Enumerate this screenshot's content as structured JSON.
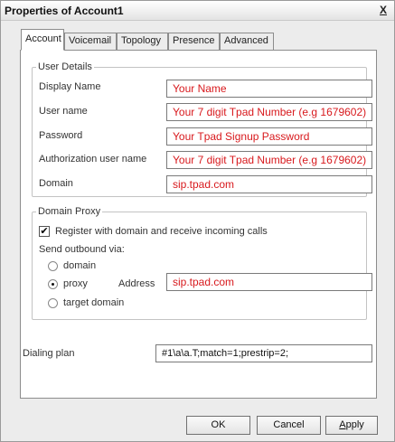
{
  "window": {
    "title": "Properties of Account1",
    "close_label": "X"
  },
  "tabs": [
    {
      "label": "Account",
      "active": true
    },
    {
      "label": "Voicemail",
      "active": false
    },
    {
      "label": "Topology",
      "active": false
    },
    {
      "label": "Presence",
      "active": false
    },
    {
      "label": "Advanced",
      "active": false
    }
  ],
  "user_details": {
    "legend": "User Details",
    "display_name": {
      "label": "Display Name",
      "value": "Your Name"
    },
    "user_name": {
      "label": "User name",
      "value": "Your 7 digit Tpad Number (e.g 1679602)"
    },
    "password": {
      "label": "Password",
      "value": "Your Tpad Signup Password"
    },
    "auth_user_name": {
      "label": "Authorization user name",
      "value": "Your 7 digit Tpad Number (e.g 1679602)"
    },
    "domain": {
      "label": "Domain",
      "value": "sip.tpad.com"
    }
  },
  "domain_proxy": {
    "legend": "Domain Proxy",
    "register_label": "Register with domain and receive incoming calls",
    "register_checked": true,
    "send_outbound_label": "Send outbound via:",
    "options": {
      "domain": "domain",
      "proxy": "proxy",
      "target_domain": "target domain"
    },
    "selected_option": "proxy",
    "address_label": "Address",
    "address_value": "sip.tpad.com"
  },
  "dialing_plan": {
    "label": "Dialing plan",
    "value": "#1\\a\\a.T;match=1;prestrip=2;"
  },
  "buttons": {
    "ok": "OK",
    "cancel": "Cancel",
    "apply_first": "A",
    "apply_rest": "pply"
  },
  "colors": {
    "field_text": "#d8191d",
    "panel_bg": "#ffffff",
    "window_bg": "#ececec"
  }
}
